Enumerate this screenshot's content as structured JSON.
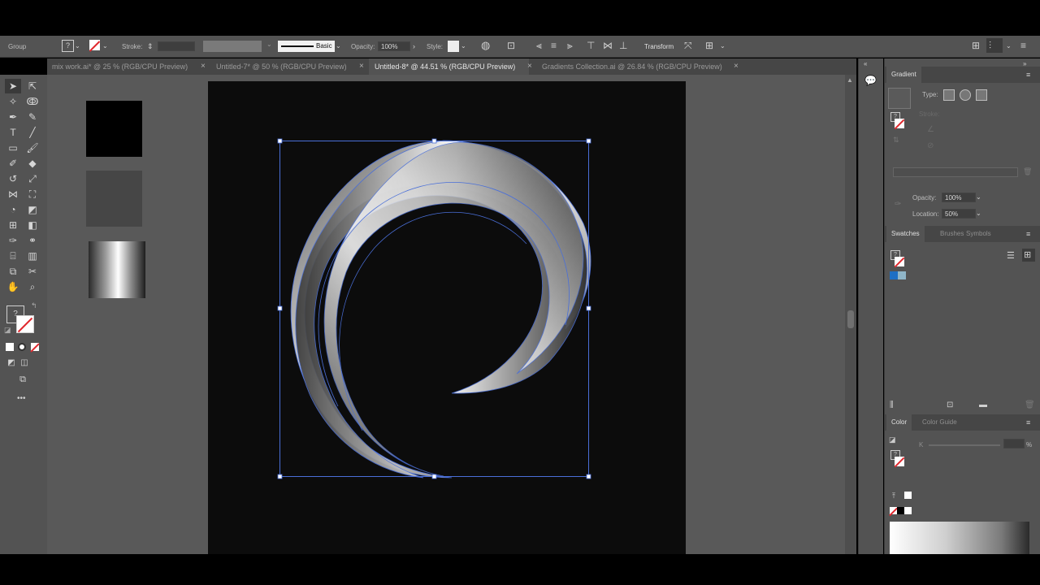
{
  "control_bar": {
    "selection_label": "Group",
    "stroke_label": "Stroke:",
    "brush_label": "Basic",
    "opacity_label": "Opacity:",
    "opacity_value": "100%",
    "style_label": "Style:",
    "transform_label": "Transform"
  },
  "tabs": [
    {
      "label": "mix work.ai* @ 25 % (RGB/CPU Preview)",
      "active": false
    },
    {
      "label": "Untitled-7* @ 50 % (RGB/CPU Preview)",
      "active": false
    },
    {
      "label": "Untitled-8* @ 44.51 % (RGB/CPU Preview)",
      "active": true
    },
    {
      "label": "Gradients Collection.ai @ 26.84 % (RGB/CPU Preview)",
      "active": false
    }
  ],
  "tab_close_glyph": "×",
  "tools_overflow": "•••",
  "gradient_panel": {
    "title": "Gradient",
    "type_label": "Type:",
    "stroke_label": "Stroke:",
    "opacity_label": "Opacity:",
    "opacity_value": "100%",
    "location_label": "Location:",
    "location_value": "50%"
  },
  "swatches_panel": {
    "tabs": [
      "Swatches",
      "Brushes",
      "Symbols"
    ],
    "active_tab": "Swatches"
  },
  "color_panel": {
    "tabs": [
      "Color",
      "Color Guide"
    ],
    "active_tab": "Color",
    "channel_label": "K",
    "percent_sign": "%"
  },
  "colors": {
    "ui_panel": "#535353",
    "ui_dark": "#464646",
    "canvas": "#595959",
    "artboard": "#0c0c0c",
    "selection": "#4a6fd8"
  }
}
